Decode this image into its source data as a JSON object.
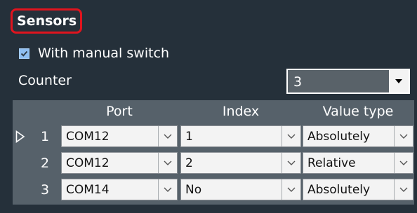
{
  "section": {
    "title": "Sensors"
  },
  "manual_switch": {
    "label": "With manual switch",
    "checked": true
  },
  "counter": {
    "label": "Counter",
    "value": "3"
  },
  "table": {
    "headers": {
      "port": "Port",
      "index": "Index",
      "value_type": "Value type"
    },
    "rows": [
      {
        "num": "1",
        "port": "COM12",
        "index": "1",
        "value_type": "Absolutely",
        "current": true
      },
      {
        "num": "2",
        "port": "COM12",
        "index": "2",
        "value_type": "Relative",
        "current": false
      },
      {
        "num": "3",
        "port": "COM14",
        "index": "No",
        "value_type": "Absolutely",
        "current": false
      }
    ]
  },
  "icons": {
    "checkbox": "check-icon",
    "dropdown": "chevron-down-icon",
    "counter_dropdown": "triangle-down-icon",
    "row_pointer": "row-pointer-icon"
  },
  "colors": {
    "background": "#25303a",
    "grid_background": "#56616a",
    "highlight_border": "#e0141e",
    "checkbox_fill": "#8fbff2"
  }
}
